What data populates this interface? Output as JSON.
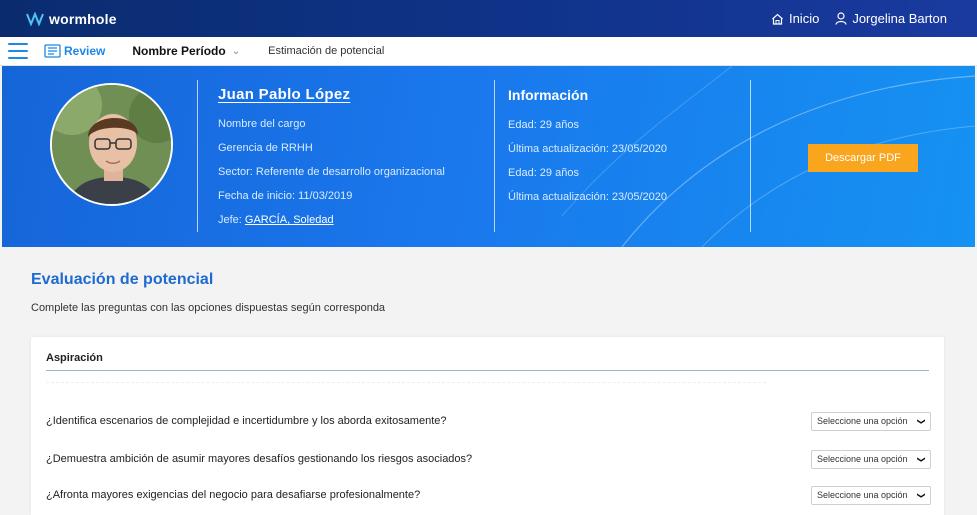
{
  "topbar": {
    "brand": "wormhole",
    "home_label": "Inicio",
    "user_name": "Jorgelina Barton"
  },
  "subnav": {
    "review_label": "Review",
    "period_label": "Nombre Período",
    "estimation_label": "Estimación de potencial"
  },
  "profile": {
    "name": "Juan Pablo López",
    "job_title": "Nombre del cargo",
    "management": "Gerencia de RRHH",
    "sector": "Sector: Referente de desarrollo organizacional",
    "start_date": "Fecha de inicio: 11/03/2019",
    "boss_prefix": "Jefe: ",
    "boss_name": "GARCÍA, Soledad"
  },
  "info": {
    "title": "Información",
    "lines": [
      "Edad: 29 años",
      "Última actualización: 23/05/2020",
      "Edad: 29 años",
      "Última actualización: 23/05/2020"
    ]
  },
  "pdf_button": "Descargar PDF",
  "evaluation": {
    "title": "Evaluación de potencial",
    "subtitle": "Complete las  preguntas con las opciones dispuestas según corresponda",
    "card_title": "Aspiración",
    "questions": [
      {
        "text": "¿Identifica escenarios de complejidad e incertidumbre y los aborda exitosamente?",
        "select": "Seleccione una opción"
      },
      {
        "text": "¿Demuestra ambición de asumir mayores desafíos gestionando los riesgos asociados?",
        "select": "Seleccione una opción"
      },
      {
        "text": "¿Afronta mayores exigencias del negocio para desafiarse profesionalmente?",
        "select": "Seleccione una opción"
      }
    ]
  },
  "colors": {
    "topbar": "#0a2c6e",
    "accent": "#1e88e5",
    "hero": "#1a77ec",
    "pdf_button": "#f9a51d",
    "section_title": "#1e6bd0"
  },
  "icons": [
    "wormhole-logo-icon",
    "home-icon",
    "user-icon",
    "hamburger-menu-icon",
    "review-icon",
    "chevron-down-icon",
    "caret-down-icon"
  ]
}
